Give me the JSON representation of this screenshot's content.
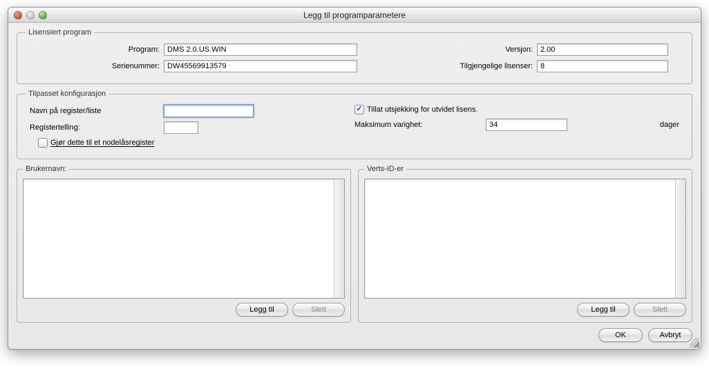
{
  "window": {
    "title": "Legg til programparametere"
  },
  "licensed": {
    "legend": "Lisensiert program",
    "program_label": "Program:",
    "program_value": "DMS 2.0.US.WIN",
    "serial_label": "Serienummer:",
    "serial_value": "DW45569913579",
    "version_label": "Versjon:",
    "version_value": "2.00",
    "avail_label": "Tilgjengelige lisenser:",
    "avail_value": "8"
  },
  "custom": {
    "legend": "Tilpasset konfigurasjon",
    "listname_label": "Navn på register/liste",
    "listname_value": "",
    "count_label": "Registertelling:",
    "count_value": "",
    "nodelock_label": "Gjør dette til et nodelåsregister",
    "nodelock_checked": false,
    "allow_checkout_label": "Tillat utsjekking for utvidet lisens.",
    "allow_checkout_checked": true,
    "max_duration_label": "Maksimum varighet:",
    "max_duration_value": "34",
    "max_duration_unit": "dager"
  },
  "panels": {
    "usernames_legend": "Brukernavn:",
    "hostids_legend": "Verts-ID-er",
    "add_label": "Legg til",
    "delete_label": "Slett"
  },
  "footer": {
    "ok_label": "OK",
    "cancel_label": "Avbryt"
  }
}
